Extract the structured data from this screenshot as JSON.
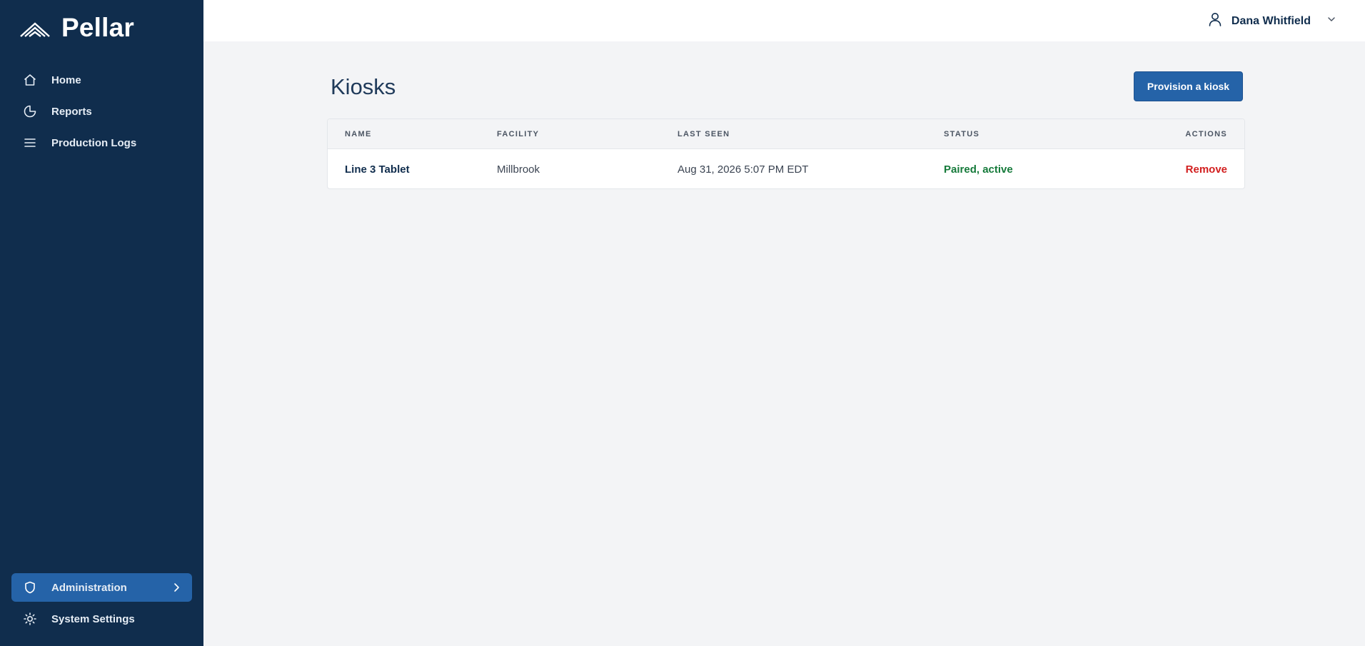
{
  "app": {
    "name": "Pellar"
  },
  "sidebar": {
    "items": [
      {
        "label": "Home",
        "icon": "home-icon"
      },
      {
        "label": "Reports",
        "icon": "pie-chart-icon"
      },
      {
        "label": "Production Logs",
        "icon": "list-icon"
      }
    ],
    "bottom_items": [
      {
        "label": "Administration",
        "icon": "shield-icon",
        "active": true
      },
      {
        "label": "System Settings",
        "icon": "sun-icon"
      }
    ]
  },
  "header": {
    "user_name": "Dana Whitfield"
  },
  "page": {
    "title": "Kiosks",
    "primary_action": "Provision a kiosk"
  },
  "table": {
    "columns": [
      "NAME",
      "FACILITY",
      "LAST SEEN",
      "STATUS",
      "ACTIONS"
    ],
    "rows": [
      {
        "name": "Line 3 Tablet",
        "facility": "Millbrook",
        "last_seen": "Aug 31, 2026 5:07 PM EDT",
        "status": "Paired, active",
        "action": "Remove"
      }
    ]
  },
  "colors": {
    "sidebar_bg": "#102d4d",
    "accent": "#2563a8",
    "status_ok": "#157a3a",
    "danger": "#d21f1f"
  }
}
